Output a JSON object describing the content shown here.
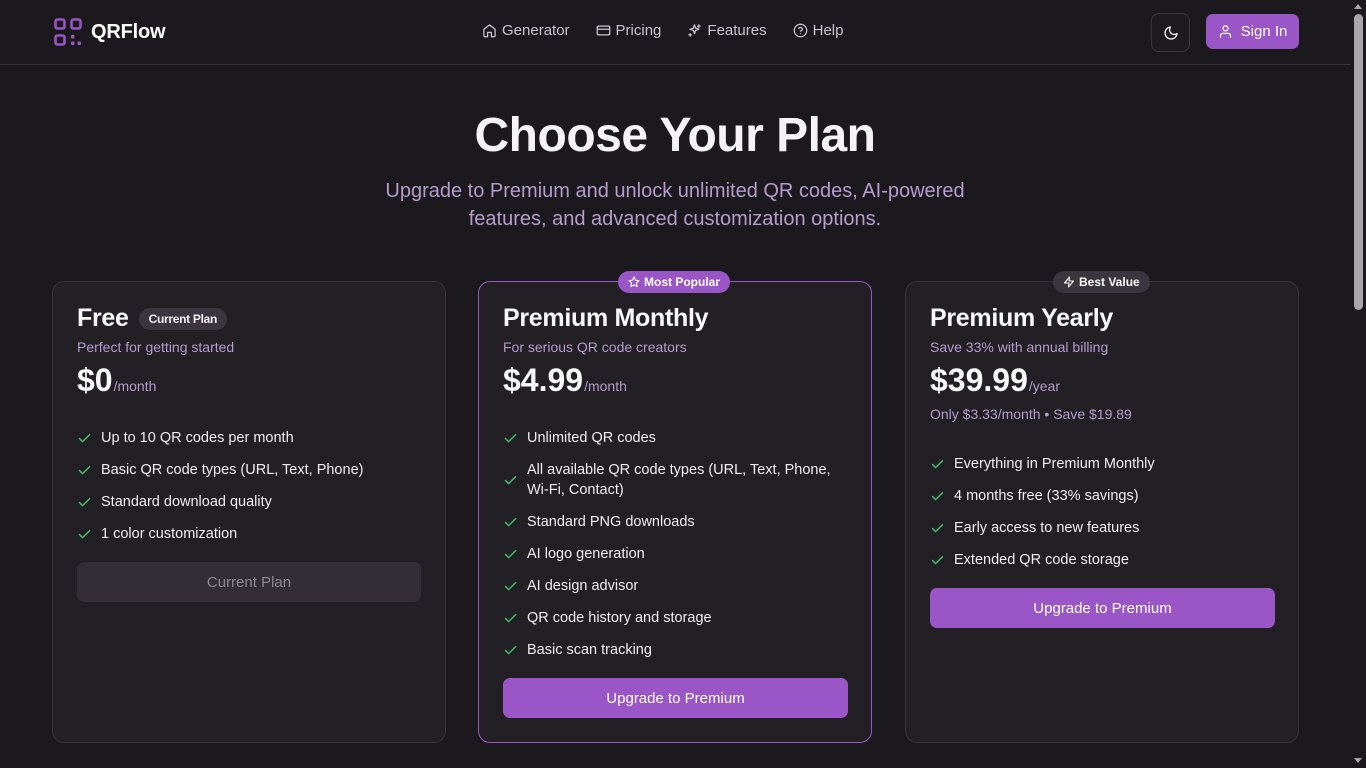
{
  "header": {
    "brand": "QRFlow",
    "nav": [
      {
        "label": "Generator",
        "icon": "home-icon"
      },
      {
        "label": "Pricing",
        "icon": "credit-card-icon"
      },
      {
        "label": "Features",
        "icon": "sparkles-icon"
      },
      {
        "label": "Help",
        "icon": "help-circle-icon"
      }
    ],
    "theme_toggle_icon": "moon-icon",
    "signin_label": "Sign In"
  },
  "hero": {
    "title": "Choose Your Plan",
    "subtitle": "Upgrade to Premium and unlock unlimited QR codes, AI-powered features, and advanced customization options."
  },
  "plans": [
    {
      "name": "Free",
      "badge": "Current Plan",
      "description": "Perfect for getting started",
      "price": "$0",
      "period": "/month",
      "features": [
        "Up to 10 QR codes per month",
        "Basic QR code types (URL, Text, Phone)",
        "Standard download quality",
        "1 color customization"
      ],
      "button": "Current Plan"
    },
    {
      "name": "Premium Monthly",
      "top_badge": "Most Popular",
      "description": "For serious QR code creators",
      "price": "$4.99",
      "period": "/month",
      "features": [
        "Unlimited QR codes",
        "All available QR code types (URL, Text, Phone, Wi-Fi, Contact)",
        "Standard PNG downloads",
        "AI logo generation",
        "AI design advisor",
        "QR code history and storage",
        "Basic scan tracking"
      ],
      "button": "Upgrade to Premium"
    },
    {
      "name": "Premium Yearly",
      "top_badge": "Best Value",
      "description": "Save 33% with annual billing",
      "price": "$39.99",
      "period": "/year",
      "note": "Only $3.33/month • Save $19.89",
      "features": [
        "Everything in Premium Monthly",
        "4 months free (33% savings)",
        "Early access to new features",
        "Extended QR code storage"
      ],
      "button": "Upgrade to Premium"
    }
  ],
  "colors": {
    "accent": "#9a55c6",
    "background": "#1c191e",
    "card": "#221f25",
    "check": "#3fbf6a",
    "muted_text": "#b59ccc"
  }
}
